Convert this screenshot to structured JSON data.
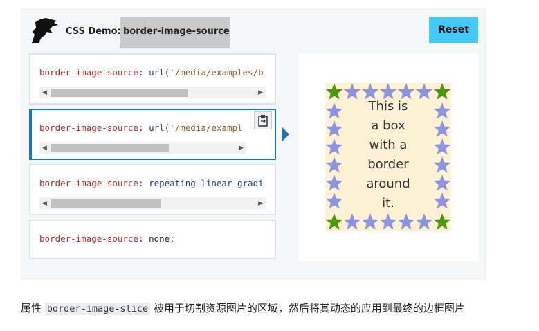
{
  "demo": {
    "title_prefix": "CSS Demo:",
    "title_property": "border-image-source",
    "reset_label": "Reset"
  },
  "choices": [
    {
      "property": "border-image-source",
      "colon": ":",
      "func": "url(",
      "arg": "'/media/examples/b",
      "scroll_visible": true,
      "scroll_fraction": 0.72
    },
    {
      "property": "border-image-source",
      "colon": ":",
      "func": "url(",
      "arg": "'/media/exampl",
      "scroll_visible": true,
      "scroll_fraction": 0.61,
      "selected": true
    },
    {
      "property": "border-image-source",
      "colon": ":",
      "func": "repeating-linear-gradi",
      "arg": "",
      "scroll_visible": true,
      "scroll_fraction": 0.55
    },
    {
      "property": "border-image-source",
      "colon": ":",
      "func": "none;",
      "arg": "",
      "scroll_visible": false
    }
  ],
  "output": {
    "lines": [
      "This is",
      "a box",
      "with a",
      "border",
      "around",
      "it."
    ],
    "colors": {
      "corner_star": "#4a9a0e",
      "edge_star": "#8d94e0",
      "box_bg": "#fdf1d6"
    }
  },
  "description": {
    "prefix": "属性",
    "code": "border-image-slice",
    "suffix": "被用于切割资源图片的区域，然后将其动态的应用到最终的边框图片"
  },
  "icons": [
    "mdn-dinosaur-logo-icon",
    "clipboard-copy-icon",
    "scroll-left-arrow-icon",
    "scroll-right-arrow-icon"
  ]
}
